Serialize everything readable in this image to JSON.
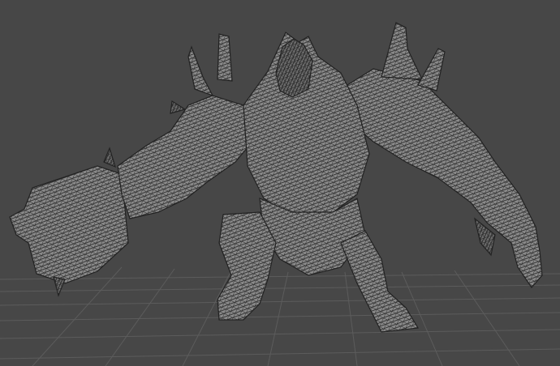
{
  "viewport": {
    "background_color": "#474747",
    "grid_color": "#5c5c5c",
    "mesh_fill_color": "#8a8a8a",
    "mesh_wire_color": "#2a2a2a",
    "mesh_dark_color": "#3a3a3a",
    "shading_mode": "wireframe-shaded",
    "model_icon": "creature-mesh-icon"
  }
}
